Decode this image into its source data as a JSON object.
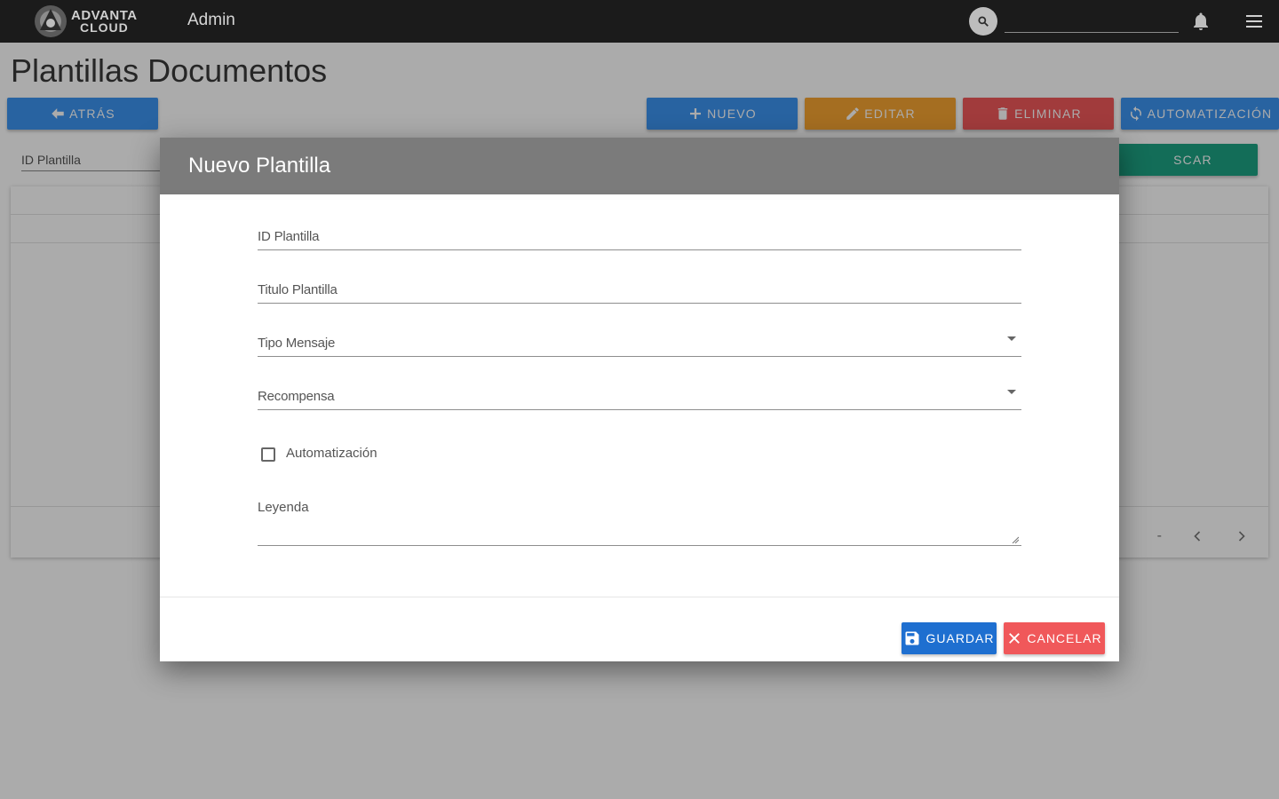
{
  "topbar": {
    "logo_line1": "ADVANTA",
    "logo_line2": "CLOUD",
    "app_title": "Admin",
    "search_icon": "search-icon",
    "search_value": "",
    "notification_icon": "bell-icon",
    "menu_icon": "hamburger-menu-icon"
  },
  "page": {
    "title": "Plantillas Documentos",
    "buttons": {
      "back": "ATRÁS",
      "new": "NUEVO",
      "edit": "EDITAR",
      "delete": "ELIMINAR",
      "automation": "AUTOMATIZACIÓN",
      "search_partial": "SCAR"
    },
    "filter_label": "ID Plantilla",
    "pager": {
      "range": "-",
      "prev_icon": "chevron-left-icon",
      "next_icon": "chevron-right-icon"
    }
  },
  "modal": {
    "title": "Nuevo Plantilla",
    "fields": {
      "id": {
        "label": "ID Plantilla",
        "value": ""
      },
      "title": {
        "label": "Titulo Plantilla",
        "value": ""
      },
      "message_type": {
        "label": "Tipo Mensaje",
        "value": ""
      },
      "reward": {
        "label": "Recompensa",
        "value": ""
      },
      "automation": {
        "label": "Automatización",
        "checked": false
      },
      "legend": {
        "label": "Leyenda",
        "value": ""
      }
    },
    "buttons": {
      "save": "GUARDAR",
      "cancel": "CANCELAR"
    }
  },
  "colors": {
    "topbar": "#1b1b1b",
    "primary": "#3d94f0",
    "warning": "#f7a532",
    "danger": "#f0585a",
    "success": "#1da384",
    "modal_header": "#7b7b7b",
    "save": "#1e6fd0"
  }
}
